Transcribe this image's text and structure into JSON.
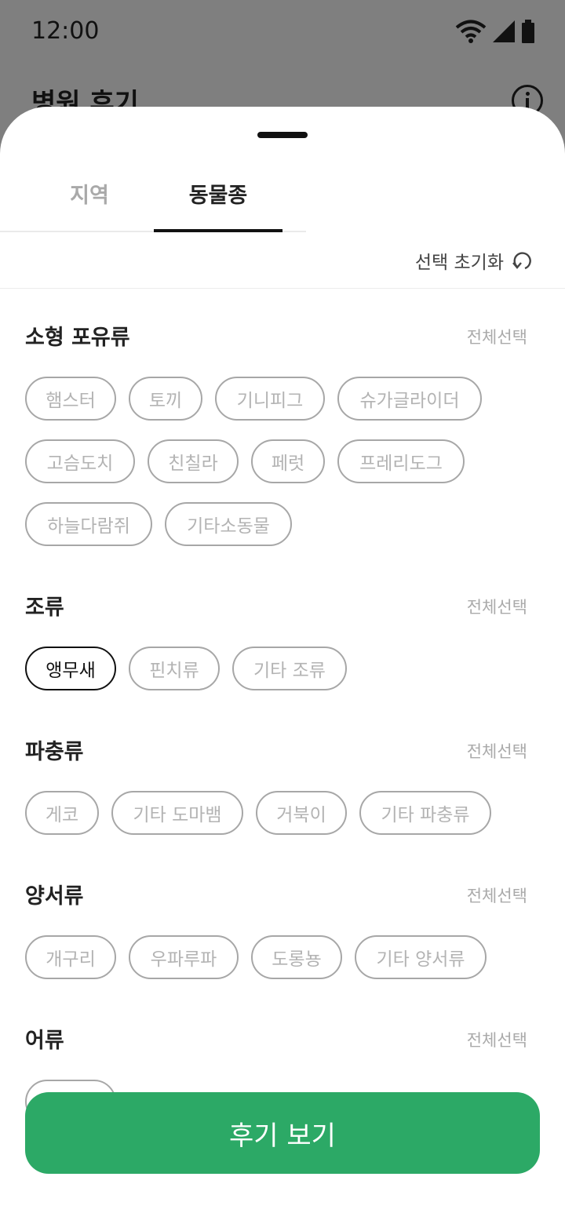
{
  "status_bar": {
    "time": "12:00"
  },
  "background": {
    "title": "병원 후기"
  },
  "tabs": [
    {
      "label": "지역"
    },
    {
      "label": "동물종"
    }
  ],
  "reset": {
    "label": "선택 초기화"
  },
  "sections": [
    {
      "title": "소형 포유류",
      "select_all": "전체선택",
      "chips": [
        "햄스터",
        "토끼",
        "기니피그",
        "슈가글라이더",
        "고슴도치",
        "친칠라",
        "페럿",
        "프레리도그",
        "하늘다람쥐",
        "기타소동물"
      ]
    },
    {
      "title": "조류",
      "select_all": "전체선택",
      "chips": [
        "앵무새",
        "핀치류",
        "기타 조류"
      ],
      "selected": [
        "앵무새"
      ]
    },
    {
      "title": "파충류",
      "select_all": "전체선택",
      "chips": [
        "게코",
        "기타 도마뱀",
        "거북이",
        "기타 파충류"
      ]
    },
    {
      "title": "양서류",
      "select_all": "전체선택",
      "chips": [
        "개구리",
        "우파루파",
        "도롱뇽",
        "기타 양서류"
      ]
    },
    {
      "title": "어류",
      "select_all": "전체선택",
      "chips": []
    }
  ],
  "cta": {
    "label": "후기 보기"
  },
  "colors": {
    "accent": "#2ca966",
    "chip_border": "#a7a7a7",
    "chip_text": "#b3b3b3",
    "selected": "#111111"
  }
}
